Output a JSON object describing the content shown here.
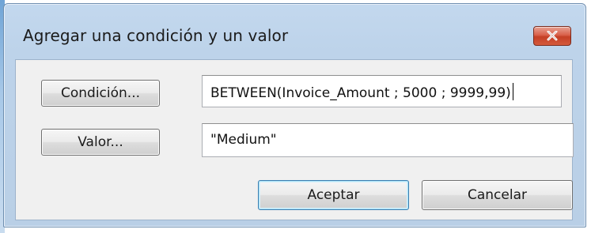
{
  "dialog": {
    "title": "Agregar una condición y un valor",
    "close_icon": "close-x-icon"
  },
  "condition": {
    "button_label": "Condición...",
    "value": "BETWEEN(Invoice_Amount ; 5000 ; 9999,99)"
  },
  "value": {
    "button_label": "Valor...",
    "value": "\"Medium\""
  },
  "actions": {
    "ok_label": "Aceptar",
    "cancel_label": "Cancelar"
  },
  "colors": {
    "titlebar": "#bdd3ea",
    "close_button": "#c43f25",
    "client": "#f0f0f0",
    "default_button_border": "#3c7fb1"
  }
}
